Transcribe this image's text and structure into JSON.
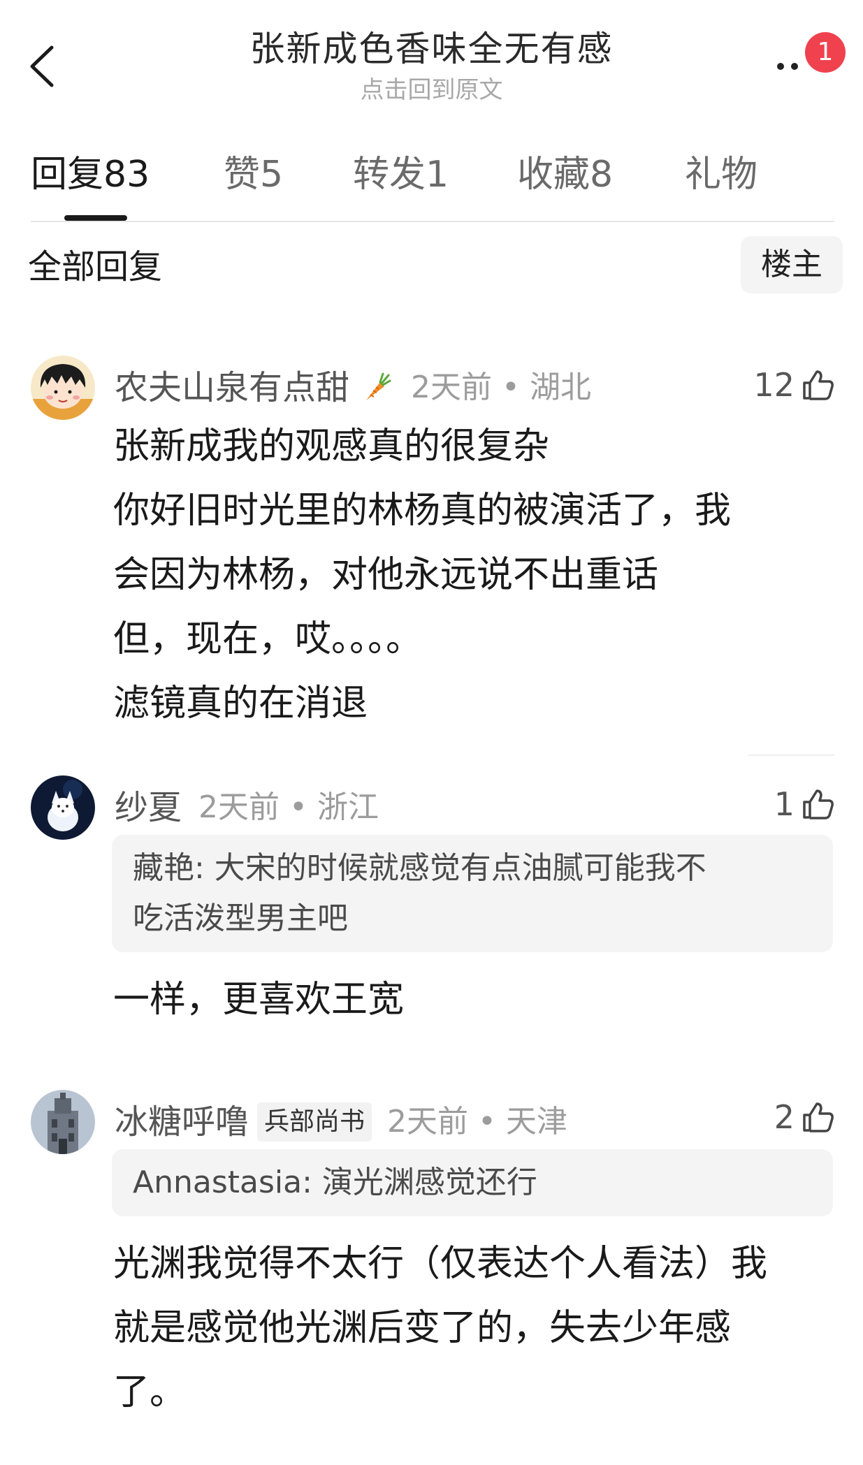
{
  "header": {
    "title": "张新成色香味全无有感",
    "subtitle": "点击回到原文",
    "notification_count": "1"
  },
  "tabs": [
    {
      "label": "回复",
      "count": "83",
      "active": true
    },
    {
      "label": "赞",
      "count": "5",
      "active": false
    },
    {
      "label": "转发",
      "count": "1",
      "active": false
    },
    {
      "label": "收藏",
      "count": "8",
      "active": false
    },
    {
      "label": "礼物",
      "count": "",
      "active": false
    }
  ],
  "filter": {
    "all_replies_label": "全部回复",
    "op_only_label": "楼主"
  },
  "comments": [
    {
      "username": "农夫山泉有点甜",
      "badge_icon": "carrot-icon",
      "time": "2天前",
      "location": "湖北",
      "likes": "12",
      "lines": [
        "张新成我的观感真的很复杂",
        "你好旧时光里的林杨真的被演活了，我",
        "会因为林杨，对他永远说不出重话",
        "但，现在，哎。。。。",
        "滤镜真的在消退"
      ]
    },
    {
      "username": "纱夏",
      "time": "2天前",
      "location": "浙江",
      "likes": "1",
      "quote_lines": [
        "藏艳: 大宋的时候就感觉有点油腻可能我不",
        "吃活泼型男主吧"
      ],
      "lines": [
        "一样，更喜欢王宽"
      ]
    },
    {
      "username": "冰糖呼噜",
      "user_tag": "兵部尚书",
      "time": "2天前",
      "location": "天津",
      "likes": "2",
      "quote_lines": [
        "Annastasia: 演光渊感觉还行"
      ],
      "lines": [
        "光渊我觉得不太行（仅表达个人看法）我",
        "就是感觉他光渊后变了的，失去少年感",
        "了。"
      ]
    }
  ],
  "meta_separator": "•",
  "colors": {
    "badge_red": "#f0414e",
    "text_primary": "#1a1a1a",
    "text_secondary": "#9c9c9c"
  }
}
